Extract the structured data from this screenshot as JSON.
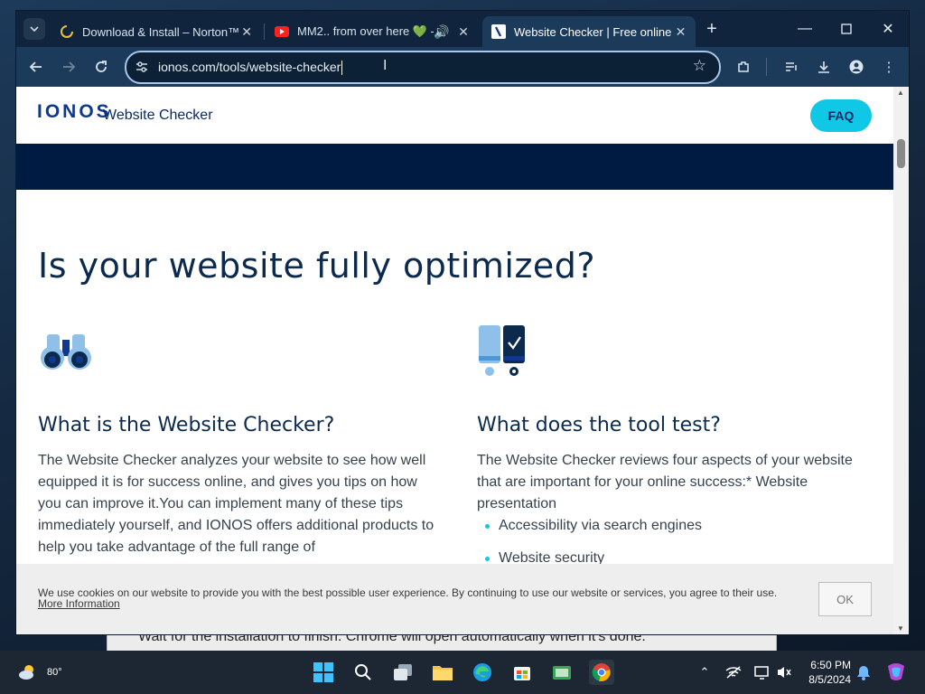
{
  "browser": {
    "tabs": [
      {
        "title": "Download & Install – Norton™",
        "favicon": "loading-spinner-icon",
        "active": false
      },
      {
        "title": "MM2.. from over here 💚 -",
        "favicon": "youtube-icon",
        "active": false,
        "audio": true
      },
      {
        "title": "Website Checker | Free online p",
        "favicon": "ionos-icon",
        "active": true
      }
    ],
    "url": "ionos.com/tools/website-checker"
  },
  "site": {
    "logo": "IONOS",
    "brand_sub": "Website Checker",
    "faq_label": "FAQ",
    "headline": "Is your website fully optimized?",
    "left": {
      "icon": "binoculars-icon",
      "title": "What is the Website Checker?",
      "body": "The Website Checker analyzes your website to see how well equipped it is for success online, and gives you tips on how you can improve it.You can implement many of these tips immediately yourself, and IONOS offers additional products to help you take advantage of the full range of"
    },
    "right": {
      "icon": "devices-check-icon",
      "title": "What does the tool test?",
      "body": "The Website Checker reviews four aspects of your website that are important for your online success:* Website presentation",
      "bullets": [
        "Accessibility via search engines",
        "Website security"
      ]
    },
    "cookie": {
      "text": "We use cookies on our website to provide you with the best possible user experience. By continuing to use our website or services, you agree to their use.",
      "link": "More Information",
      "ok_label": "OK"
    }
  },
  "background_window": {
    "text": "Wait for the installation to finish. Chrome will open automatically when it's done."
  },
  "taskbar": {
    "temperature": "80°",
    "time": "6:50 PM",
    "date": "8/5/2024"
  },
  "colors": {
    "ionos_blue": "#11388c",
    "navy_band": "#001b41",
    "faq_cyan": "#11c7e6",
    "chrome_frame": "#10253d",
    "chrome_toolbar": "#1c3a5a"
  }
}
